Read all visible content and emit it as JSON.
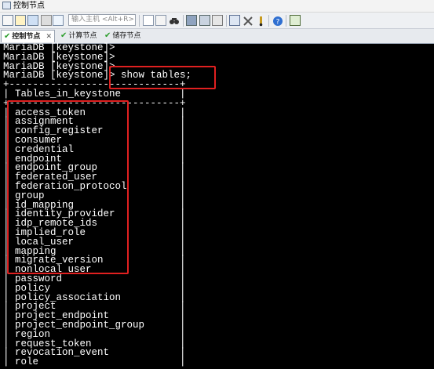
{
  "window": {
    "title": "控制节点"
  },
  "toolbar": {
    "host_input_placeholder": "输入主机 <Alt+R>"
  },
  "tabs": [
    {
      "label": "控制节点",
      "active": true
    },
    {
      "label": "计算节点",
      "active": false
    },
    {
      "label": "储存节点",
      "active": false
    }
  ],
  "terminal": {
    "lines": [
      "MariaDB [keystone]>",
      "MariaDB [keystone]>",
      "MariaDB [keystone]>",
      "MariaDB [keystone]> show tables;",
      "+-----------------------------+",
      "| Tables_in_keystone          |",
      "+-----------------------------+",
      "| access_token                |",
      "| assignment                  |",
      "| config_register             |",
      "| consumer                    |",
      "| credential                  |",
      "| endpoint                    |",
      "| endpoint_group              |",
      "| federated_user              |",
      "| federation_protocol         |",
      "| group                       |",
      "| id_mapping                  |",
      "| identity_provider           |",
      "| idp_remote_ids              |",
      "| implied_role                |",
      "| local_user                  |",
      "| mapping                     |",
      "| migrate_version             |",
      "| nonlocal_user               |",
      "| password                    |",
      "| policy                      |",
      "| policy_association          |",
      "| project                     |",
      "| project_endpoint            |",
      "| project_endpoint_group      |",
      "| region                      |",
      "| request_token               |",
      "| revocation_event            |",
      "| role                        |"
    ]
  },
  "colors": {
    "terminal_bg": "#000000",
    "terminal_fg": "#ffffff",
    "highlight_box": "#e02020"
  }
}
